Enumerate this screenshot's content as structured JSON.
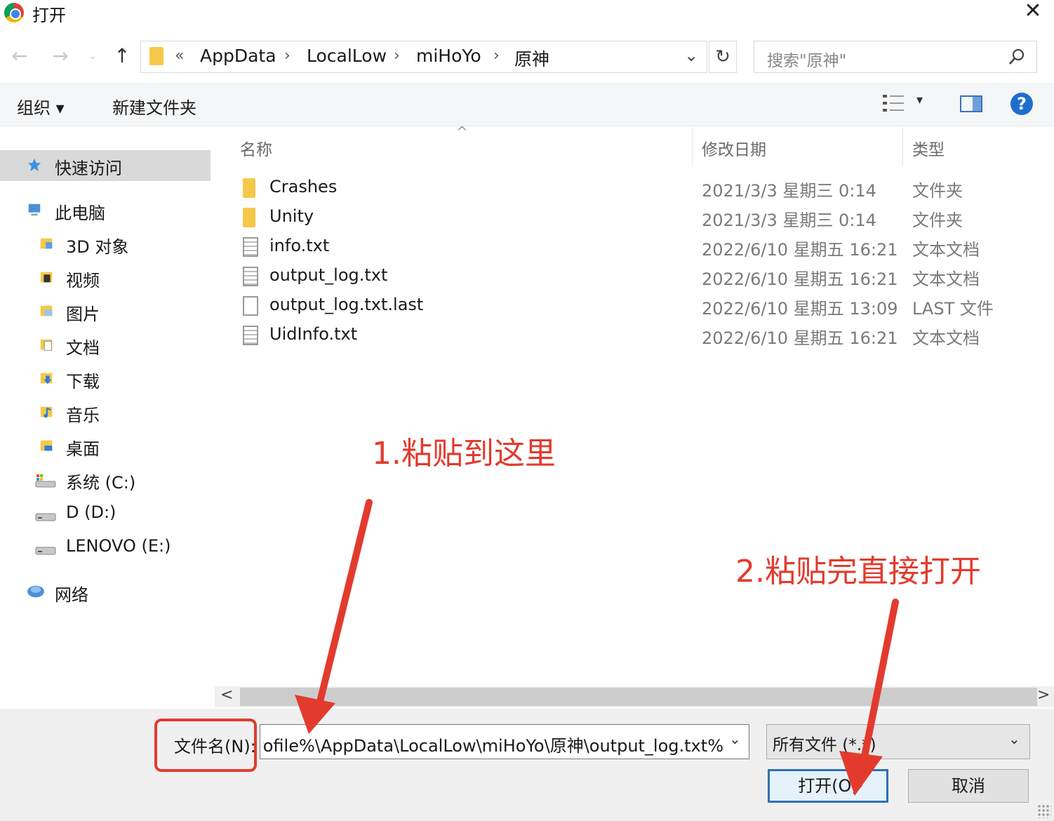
{
  "window": {
    "title": "打开",
    "close_glyph": "✕"
  },
  "nav": {
    "back": "←",
    "forward": "→",
    "recent": "⌄",
    "up": "↑"
  },
  "address": {
    "overflow": "«",
    "crumbs": [
      "AppData",
      "LocalLow",
      "miHoYo",
      "原神"
    ],
    "separator": "›",
    "dropdown": "⌄",
    "refresh": "↻"
  },
  "search": {
    "placeholder": "搜索\"原神\""
  },
  "toolbar": {
    "organize_label": "组织 ▾",
    "new_folder_label": "新建文件夹",
    "view_dropdown": "▾",
    "help": "?"
  },
  "sidebar": {
    "items": [
      {
        "label": "快速访问",
        "icon": "star-icon",
        "selected": true
      },
      {
        "label": "此电脑",
        "icon": "computer-icon"
      },
      {
        "label": "3D 对象",
        "icon": "3d-objects-icon"
      },
      {
        "label": "视频",
        "icon": "video-icon"
      },
      {
        "label": "图片",
        "icon": "pictures-icon"
      },
      {
        "label": "文档",
        "icon": "documents-icon"
      },
      {
        "label": "下载",
        "icon": "downloads-icon"
      },
      {
        "label": "音乐",
        "icon": "music-icon"
      },
      {
        "label": "桌面",
        "icon": "desktop-icon"
      },
      {
        "label": "系统 (C:)",
        "icon": "drive-c-icon"
      },
      {
        "label": "D (D:)",
        "icon": "drive-icon"
      },
      {
        "label": "LENOVO (E:)",
        "icon": "drive-icon"
      },
      {
        "label": "网络",
        "icon": "network-icon"
      }
    ]
  },
  "files": {
    "columns": {
      "name": "名称",
      "date": "修改日期",
      "type": "类型",
      "sort_indicator": "^"
    },
    "rows": [
      {
        "name": "Crashes",
        "date": "2021/3/3 星期三 0:14",
        "type": "文件夹",
        "icon": "folder-icon"
      },
      {
        "name": "Unity",
        "date": "2021/3/3 星期三 0:14",
        "type": "文件夹",
        "icon": "folder-icon"
      },
      {
        "name": "info.txt",
        "date": "2022/6/10 星期五 16:21",
        "type": "文本文档",
        "icon": "text-file-icon"
      },
      {
        "name": "output_log.txt",
        "date": "2022/6/10 星期五 16:21",
        "type": "文本文档",
        "icon": "text-file-icon"
      },
      {
        "name": "output_log.txt.last",
        "date": "2022/6/10 星期五 13:09",
        "type": "LAST 文件",
        "icon": "blank-file-icon"
      },
      {
        "name": "UidInfo.txt",
        "date": "2022/6/10 星期五 16:21",
        "type": "文本文档",
        "icon": "text-file-icon"
      }
    ]
  },
  "scrollbar": {
    "left": "<",
    "right": ">"
  },
  "bottom": {
    "filename_label": "文件名(N):",
    "filename_value": "%userprofile%\\AppData\\LocalLow\\miHoYo\\原神\\output_log.txt",
    "filename_drop": "⌄",
    "filetype_value": "所有文件 (*.*)",
    "filetype_drop": "⌄",
    "open_label": "打开(O)",
    "cancel_label": "取消"
  },
  "annotations": {
    "step1": "1.粘贴到这里",
    "step2": "2.粘贴完直接打开",
    "color": "#e23b2e"
  }
}
